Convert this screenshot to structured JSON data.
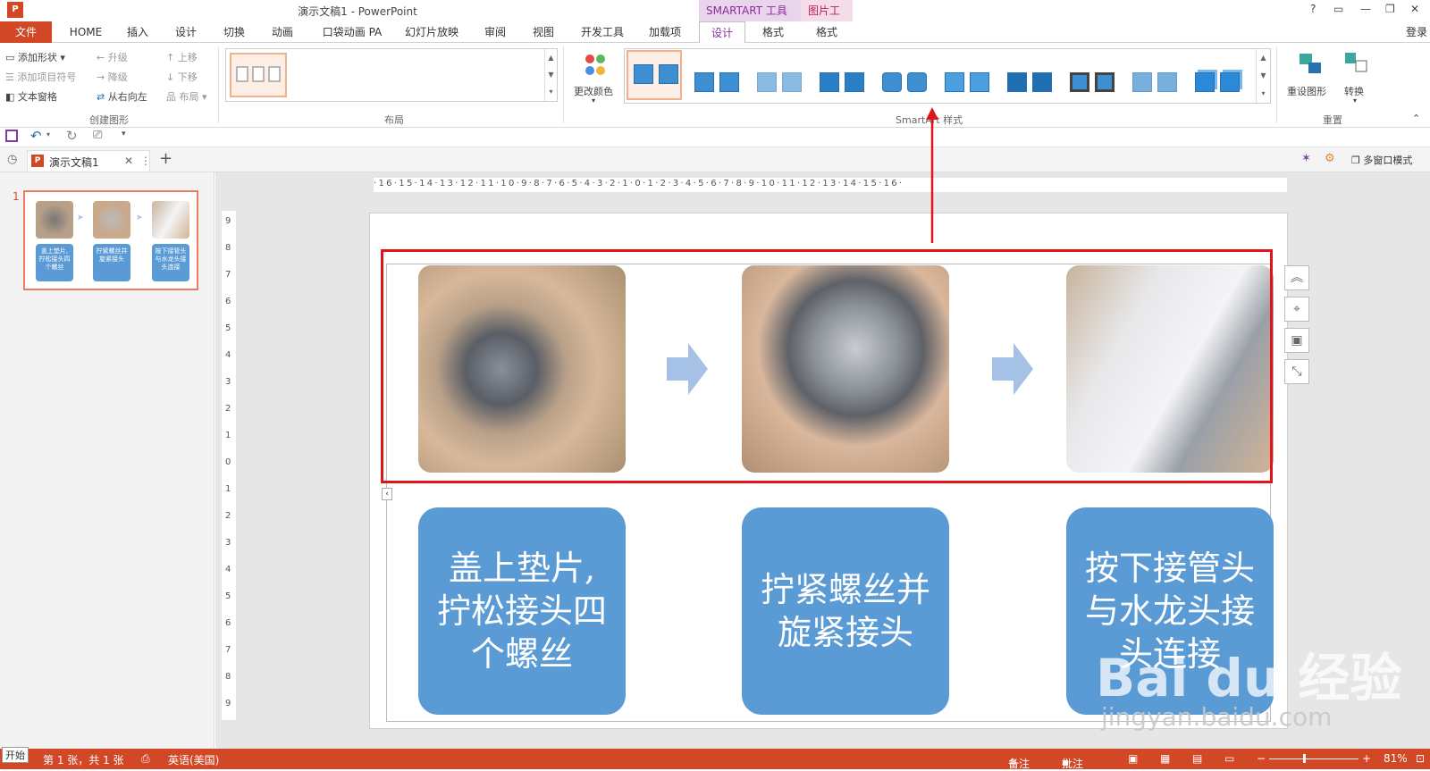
{
  "window": {
    "app_icon": "P",
    "title": "演示文稿1 - PowerPoint",
    "context_smartart": "SMARTART 工具",
    "context_picture": "图片工具",
    "help": "?",
    "ribbon_display": "▭",
    "minimize": "—",
    "restore": "❐",
    "close": "✕",
    "login": "登录"
  },
  "tabs": {
    "file": "文件",
    "home": "HOME",
    "insert": "插入",
    "design_main": "设计",
    "transitions": "切换",
    "animations": "动画",
    "pocket_anim": "口袋动画 PA",
    "slideshow": "幻灯片放映",
    "review": "审阅",
    "view": "视图",
    "developer": "开发工具",
    "addins": "加载项",
    "sa_design": "设计",
    "sa_format": "格式",
    "pic_format": "格式"
  },
  "ribbon": {
    "add_shape": "添加形状",
    "add_bullet": "添加项目符号",
    "text_pane": "文本窗格",
    "promote": "升级",
    "demote": "降级",
    "rtl": "从右向左",
    "move_up": "上移",
    "move_down": "下移",
    "layout_btn": "布局",
    "group_create": "创建图形",
    "group_layout": "布局",
    "change_colors": "更改颜色",
    "group_styles": "SmartArt 样式",
    "reset": "重设图形",
    "convert": "转换",
    "group_reset": "重置",
    "collapse": "⌃"
  },
  "qat": {
    "save": "save-icon",
    "undo": "undo-icon",
    "redo": "redo-icon",
    "present": "presentation-icon",
    "customize": "▾"
  },
  "doc_tab": {
    "name": "演示文稿1",
    "close": "✕",
    "more": "⋮",
    "new": "+",
    "multi_window": "多窗口模式"
  },
  "thumbnail": {
    "number": "1",
    "t1": "盖上垫片,拧松接头四个螺丝",
    "t2": "拧紧螺丝并旋紧接头",
    "t3": "按下接管头与水龙头接头连接"
  },
  "ruler": {
    "h": "·16·15·14·13·12·11·10·9·8·7·6·5·4·3·2·1·0·1·2·3·4·5·6·7·8·9·10·11·12·13·14·15·16·",
    "v": [
      "9",
      "8",
      "7",
      "6",
      "5",
      "4",
      "3",
      "2",
      "1",
      "0",
      "1",
      "2",
      "3",
      "4",
      "5",
      "6",
      "7",
      "8",
      "9"
    ]
  },
  "cards": {
    "c1": "盖上垫片,拧松接头四个螺丝",
    "c2": "拧紧螺丝并旋紧接头",
    "c3": "按下接管头与水龙头接头连接"
  },
  "watermark": {
    "logo": "Bai du 经验",
    "url": "jingyan.baidu.com"
  },
  "status": {
    "start_tip": "开始",
    "slide_info": "第 1 张，共 1 张",
    "language": "英语(美国)",
    "notes": "备注",
    "comments": "批注",
    "zoom": "81%"
  },
  "colors": {
    "accent": "#d24726",
    "card": "#5b9bd5",
    "arrow": "#a6c1e6",
    "selection": "#e0141b",
    "context": "#8a2c9c"
  }
}
